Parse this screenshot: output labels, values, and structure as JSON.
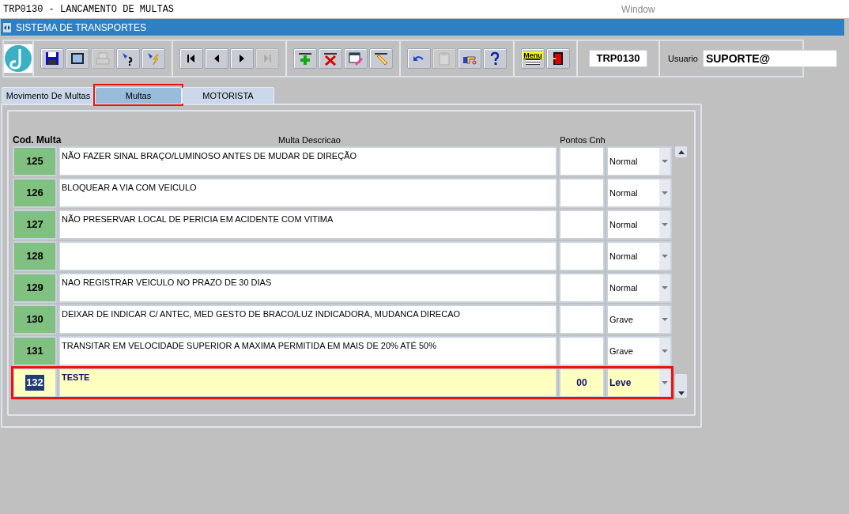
{
  "window": {
    "title": "TRP0130 - LANCAMENTO DE MULTAS",
    "caption": "Window"
  },
  "app_bar": {
    "title": "SISTEMA DE TRANSPORTES"
  },
  "toolbar": {
    "groups": [
      {
        "buttons": [
          {
            "disabled": false
          },
          {
            "disabled": false
          },
          {
            "disabled": true
          },
          {
            "disabled": false
          },
          {
            "disabled": false
          }
        ]
      },
      {
        "buttons": [
          {
            "disabled": false
          },
          {
            "disabled": false
          },
          {
            "disabled": false
          },
          {
            "disabled": true
          }
        ]
      },
      {
        "buttons": [
          {
            "disabled": false
          },
          {
            "disabled": false
          },
          {
            "disabled": false
          },
          {
            "disabled": false
          }
        ]
      },
      {
        "buttons": [
          {
            "disabled": false
          },
          {
            "disabled": true
          },
          {
            "disabled": false
          },
          {
            "disabled": false
          }
        ]
      },
      {
        "buttons": [
          {
            "disabled": false,
            "label": "Menu"
          },
          {
            "disabled": false
          }
        ]
      }
    ],
    "form_code": "TRP0130",
    "user_label": "Usuario",
    "user_value": "SUPORTE@"
  },
  "tabs": [
    {
      "label": "Movimento De Multas",
      "selected": false
    },
    {
      "label": "Multas",
      "selected": true
    },
    {
      "label": "MOTORISTA",
      "selected": false
    }
  ],
  "table": {
    "columns": [
      "Cod. Multa",
      "Multa Descricao",
      "Pontos Cnh"
    ],
    "rows": [
      {
        "code": "125",
        "description": "NÃO FAZER SINAL BRAÇO/LUMINOSO ANTES DE MUDAR DE DIREÇÃO",
        "points": "",
        "severity": "Normal",
        "selected": false
      },
      {
        "code": "126",
        "description": "BLOQUEAR A VIA COM  VEICULO",
        "points": "",
        "severity": "Normal",
        "selected": false
      },
      {
        "code": "127",
        "description": "NÃO PRESERVAR LOCAL DE PERICIA EM ACIDENTE COM VITIMA",
        "points": "",
        "severity": "Normal",
        "selected": false
      },
      {
        "code": "128",
        "description": "",
        "points": "",
        "severity": "Normal",
        "selected": false
      },
      {
        "code": "129",
        "description": "NAO REGISTRAR VEICULO NO PRAZO DE 30 DIAS",
        "points": "",
        "severity": "Normal",
        "selected": false
      },
      {
        "code": "130",
        "description": "DEIXAR DE INDICAR C/ ANTEC, MED GESTO DE BRACO/LUZ INDICADORA, MUDANCA DIRECAO",
        "points": "",
        "severity": "Grave",
        "selected": false
      },
      {
        "code": "131",
        "description": "TRANSITAR EM VELOCIDADE SUPERIOR A MAXIMA PERMITIDA EM MAIS DE 20% ATÉ 50%",
        "points": "",
        "severity": "Grave",
        "selected": false
      },
      {
        "code": "132",
        "description": "TESTE",
        "points": "00",
        "severity": "Leve",
        "selected": true
      }
    ]
  }
}
